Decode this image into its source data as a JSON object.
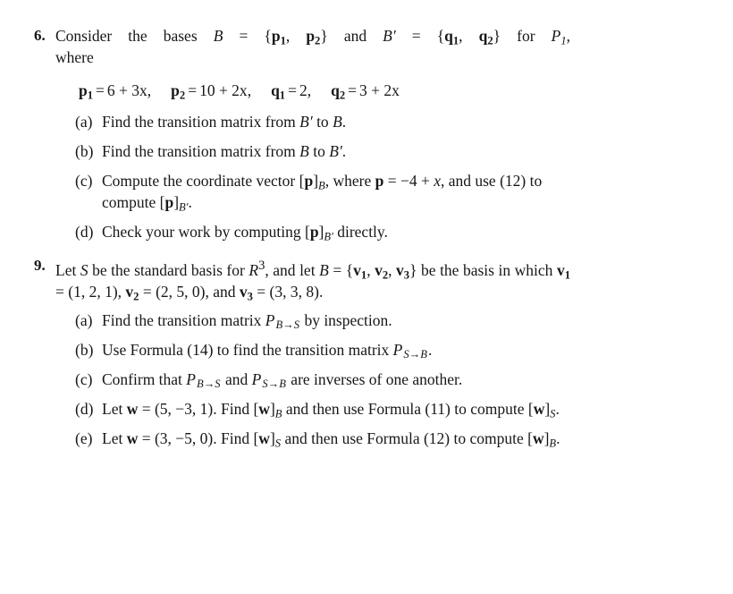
{
  "page": {
    "background_color": "#ffffff",
    "text_color": "#171717"
  },
  "exercises": [
    {
      "number": "6.",
      "stem_line_1": "Consider the bases ",
      "stem_B": "B",
      "stem_eq1": " = {",
      "stem_p1": "p",
      "stem_p1_sub": "1",
      "stem_comma1": ", ",
      "stem_p2": "p",
      "stem_p2_sub": "2",
      "stem_close1": "} and ",
      "stem_Bprime": "B",
      "stem_Bprime_mark": "′",
      "stem_eq2": " = {",
      "stem_q1": "q",
      "stem_q1_sub": "1",
      "stem_comma2": ", ",
      "stem_q2": "q",
      "stem_q2_sub": "2",
      "stem_close2": "} for ",
      "stem_P": "P",
      "stem_P_sub": "1",
      "stem_tail": ",",
      "stem_line_2": "where",
      "equations": [
        {
          "lhs_symbol": "p",
          "lhs_sub": "1",
          "relation": "=",
          "rhs": "6 + 3x",
          "separator": ","
        },
        {
          "lhs_symbol": "p",
          "lhs_sub": "2",
          "relation": "=",
          "rhs": "10 + 2x",
          "separator": ","
        },
        {
          "lhs_symbol": "q",
          "lhs_sub": "1",
          "relation": "=",
          "rhs": "2",
          "separator": ","
        },
        {
          "lhs_symbol": "q",
          "lhs_sub": "2",
          "relation": "=",
          "rhs": "3 + 2x",
          "separator": ""
        }
      ],
      "parts": [
        {
          "label": "(a)",
          "text_1": "Find the transition matrix from ",
          "sym_1": "B",
          "sym_1_prime": "′",
          "text_2": " to ",
          "sym_2": "B",
          "text_3": "."
        },
        {
          "label": "(b)",
          "text_1": "Find the transition matrix from ",
          "sym_1": "B",
          "text_2": " to ",
          "sym_2": "B",
          "sym_2_prime": "′",
          "text_3": "."
        },
        {
          "label": "(c)",
          "text_1": "Compute the coordinate vector [",
          "vec_1": "p",
          "text_2": "]",
          "sub_1": "B",
          "text_3": ", where ",
          "vec_2": "p",
          "text_4": " = −4 + ",
          "var_1": "x",
          "text_5": ", and use (12) to compute [",
          "vec_3": "p",
          "text_6": "]",
          "sub_2": "B",
          "sub_2_prime": "′",
          "text_7": "."
        },
        {
          "label": "(d)",
          "text_1": "Check your work by computing [",
          "vec_1": "p",
          "text_2": "]",
          "sub_1": "B",
          "sub_1_prime": "′",
          "text_3": " directly."
        }
      ]
    },
    {
      "number": "9.",
      "stem_a": "Let ",
      "stem_S": "S",
      "stem_b": " be the standard basis for ",
      "stem_R": "R",
      "stem_R_sup": "3",
      "stem_c": ", and let ",
      "stem_B": "B",
      "stem_d": " = {",
      "stem_v1": "v",
      "stem_v1_sub": "1",
      "stem_e": ", ",
      "stem_v2": "v",
      "stem_v2_sub": "2",
      "stem_f": ", ",
      "stem_v3": "v",
      "stem_v3_sub": "3",
      "stem_g": "} be the basis in which ",
      "stem_v1b": "v",
      "stem_v1b_sub": "1",
      "stem_h": " = (1, 2, 1), ",
      "stem_v2b": "v",
      "stem_v2b_sub": "2",
      "stem_i": " = (2, 5, 0), and ",
      "stem_v3b": "v",
      "stem_v3b_sub": "3",
      "stem_j": " = (3, 3, 8).",
      "parts": [
        {
          "label": "(a)",
          "text_1": "Find the transition matrix ",
          "mat_1": "P",
          "mat_1_sub": "B→S",
          "text_2": " by inspection."
        },
        {
          "label": "(b)",
          "text_1": "Use Formula (14) to find the transition matrix ",
          "mat_1": "P",
          "mat_1_sub": "S→B",
          "text_2": "."
        },
        {
          "label": "(c)",
          "text_1": "Confirm that ",
          "mat_1": "P",
          "mat_1_sub": "B→S",
          "text_2": " and ",
          "mat_2": "P",
          "mat_2_sub": "S→B",
          "text_3": " are inverses of one another."
        },
        {
          "label": "(d)",
          "text_1": "Let ",
          "vec_1": "w",
          "text_2": " = (5, −3, 1). Find [",
          "vec_2": "w",
          "text_3": "]",
          "sub_1": "B",
          "text_4": " and then use Formula (11) to compute [",
          "vec_3": "w",
          "text_5": "]",
          "sub_2": "S",
          "text_6": "."
        },
        {
          "label": "(e)",
          "text_1": "Let ",
          "vec_1": "w",
          "text_2": " = (3, −5, 0). Find [",
          "vec_2": "w",
          "text_3": "]",
          "sub_1": "S",
          "text_4": " and then use Formula (12) to compute [",
          "vec_3": "w",
          "text_5": "]",
          "sub_2": "B",
          "text_6": "."
        }
      ]
    }
  ]
}
